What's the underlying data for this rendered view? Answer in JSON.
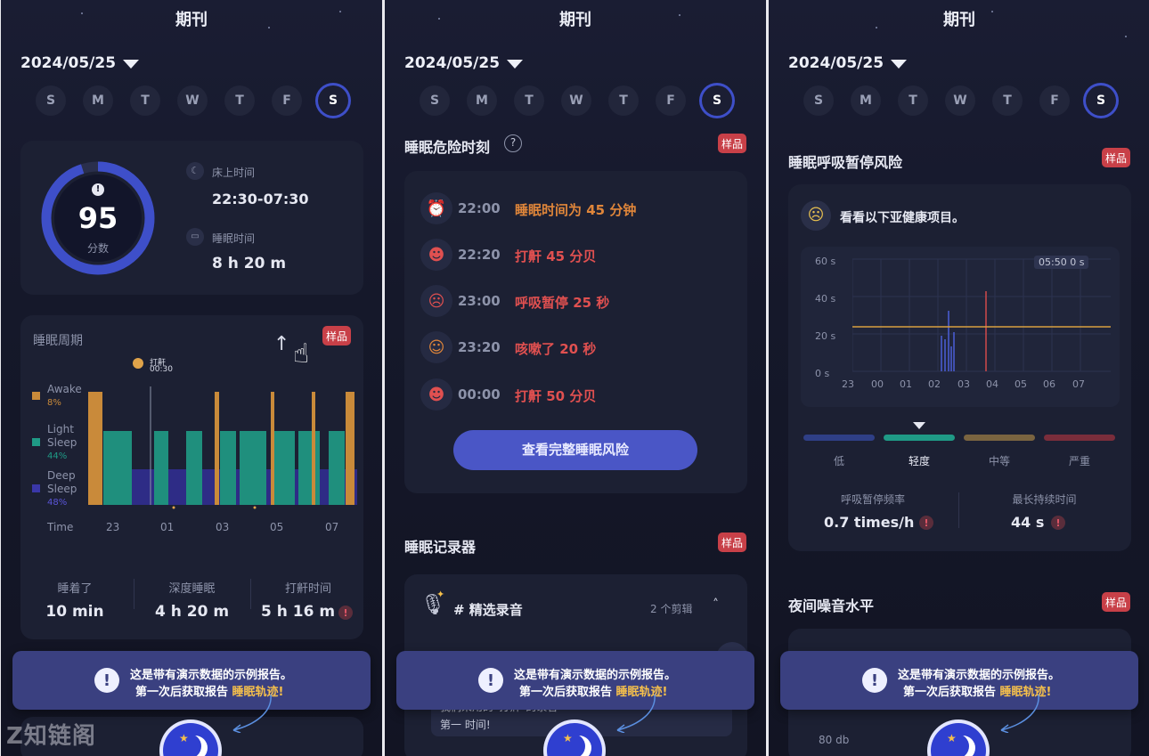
{
  "common": {
    "title": "期刊",
    "date": "2024/05/25",
    "days": [
      "S",
      "M",
      "T",
      "W",
      "T",
      "F",
      "S"
    ],
    "sample_badge": "样品",
    "banner_line1": "这是带有演示数据的示例报告。",
    "banner_line2_prefix": "第一次后获取报告 ",
    "banner_line2_highlight": "睡眠轨迹!",
    "colors": {
      "accent": "#3e4fc9",
      "badge": "#c84048",
      "highlight": "#f6c04b"
    }
  },
  "screen1": {
    "score": "95",
    "score_label": "分数",
    "bed_time_label": "床上时间",
    "bed_time_value": "22:30-07:30",
    "sleep_time_label": "睡眠时间",
    "sleep_time_value": "8 h 20 m",
    "cycle_title": "睡眠周期",
    "snore_tag": "打鼾",
    "snore_tag_time": "00:30",
    "legend": [
      {
        "label1": "Awake",
        "label2": "",
        "pct": "8%",
        "color": "#c98a3a"
      },
      {
        "label1": "Light",
        "label2": "Sleep",
        "pct": "44%",
        "color": "#1f9a86"
      },
      {
        "label1": "Deep",
        "label2": "Sleep",
        "pct": "48%",
        "color": "#3a37a8"
      }
    ],
    "time_label": "Time",
    "x_ticks": [
      "23",
      "01",
      "03",
      "05",
      "07"
    ],
    "stats": [
      {
        "label": "睡着了",
        "value": "10 min"
      },
      {
        "label": "深度睡眠",
        "value": "4 h 20 m"
      },
      {
        "label": "打鼾时间",
        "value": "5 h 16 m"
      }
    ]
  },
  "screen2": {
    "risk_title": "睡眠危险时刻",
    "help": "?",
    "risks": [
      {
        "time": "22:00",
        "desc": "睡眠时间为 45 分钟",
        "icon": "alarm-icon",
        "glyph": "⏰",
        "color": "#e0863a"
      },
      {
        "time": "22:20",
        "desc": "打鼾 45 分贝",
        "icon": "snore-icon",
        "glyph": "☻",
        "color": "#e05050"
      },
      {
        "time": "23:00",
        "desc": "呼吸暂停 25 秒",
        "icon": "apnea-icon",
        "glyph": "☹",
        "color": "#e05050"
      },
      {
        "time": "23:20",
        "desc": "咳嗽了 20 秒",
        "icon": "cough-icon",
        "glyph": "☺",
        "color": "#e05050"
      },
      {
        "time": "00:00",
        "desc": "打鼾 50 分贝",
        "icon": "snore-icon",
        "glyph": "☻",
        "color": "#e05050"
      }
    ],
    "view_full_button": "查看完整睡眠风险",
    "recorder_title": "睡眠记录器",
    "recordings_label": "# 精选录音",
    "clips_count": "2 个剪辑",
    "partial_text1": "我们采用的“打鼾”的录音",
    "partial_text2": "第一 时间!"
  },
  "screen3": {
    "apnea_title": "睡眠呼吸暂停风险",
    "note": "看看以下亚健康项目。",
    "y_ticks": [
      "60 s",
      "40 s",
      "20 s",
      "0 s"
    ],
    "x_ticks": [
      "23",
      "00",
      "01",
      "02",
      "03",
      "04",
      "05",
      "06",
      "07"
    ],
    "cursor_label": "05:50 0 s",
    "severity": [
      {
        "label": "低",
        "color": "#2f3f86"
      },
      {
        "label": "轻度",
        "color": "#1f9a86"
      },
      {
        "label": "中等",
        "color": "#7a6440"
      },
      {
        "label": "严重",
        "color": "#7a2d3b"
      }
    ],
    "freq_label": "呼吸暂停频率",
    "freq_value": "0.7 times/h",
    "longest_label": "最长持续时间",
    "longest_value": "44 s",
    "noise_title": "夜间噪音水平",
    "noise_y_tick": "80 db"
  },
  "chart_data": [
    {
      "type": "bar",
      "title": "",
      "x": [
        "23",
        "01",
        "03",
        "05",
        "07"
      ],
      "series": [
        {
          "name": "Awake",
          "values": [
            1,
            0,
            0,
            0,
            1
          ]
        },
        {
          "name": "Light Sleep",
          "values": [
            1,
            1,
            1,
            1,
            1
          ]
        },
        {
          "name": "Deep Sleep",
          "values": [
            1,
            1,
            1,
            1,
            1
          ]
        }
      ]
    },
    {
      "type": "bar",
      "title": "",
      "xlabel": "",
      "ylabel": "",
      "x": [
        "23",
        "00",
        "01",
        "02",
        "03",
        "04",
        "05",
        "06",
        "07"
      ],
      "ylim": [
        0,
        60
      ],
      "threshold": 20,
      "series": [
        {
          "name": "",
          "values": [
            0,
            0,
            0,
            33,
            44,
            0,
            0,
            0,
            0
          ]
        }
      ]
    }
  ]
}
